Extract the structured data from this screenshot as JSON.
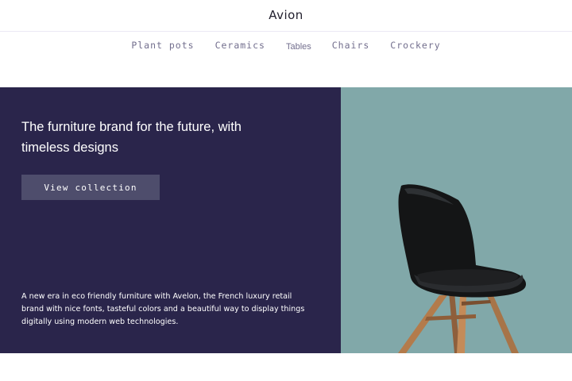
{
  "header": {
    "brand": "Avion"
  },
  "nav": {
    "items": [
      {
        "label": "Plant pots"
      },
      {
        "label": "Ceramics"
      },
      {
        "label": "Tables"
      },
      {
        "label": "Chairs"
      },
      {
        "label": "Crockery"
      }
    ]
  },
  "hero": {
    "headline_line1": "The furniture brand for the future, with",
    "headline_line2": "timeless designs",
    "cta_label": "View collection",
    "blurb": "A new era in eco friendly furniture with Avelon, the French luxury retail brand with nice fonts, tasteful colors and a beautiful way to display things digitally using modern web technologies.",
    "image_icon": "chair-image"
  },
  "colors": {
    "primary": "#2A254B",
    "cta": "#4E4D6C",
    "image_bg": "#81A8A9",
    "nav_text": "#726E8D"
  }
}
